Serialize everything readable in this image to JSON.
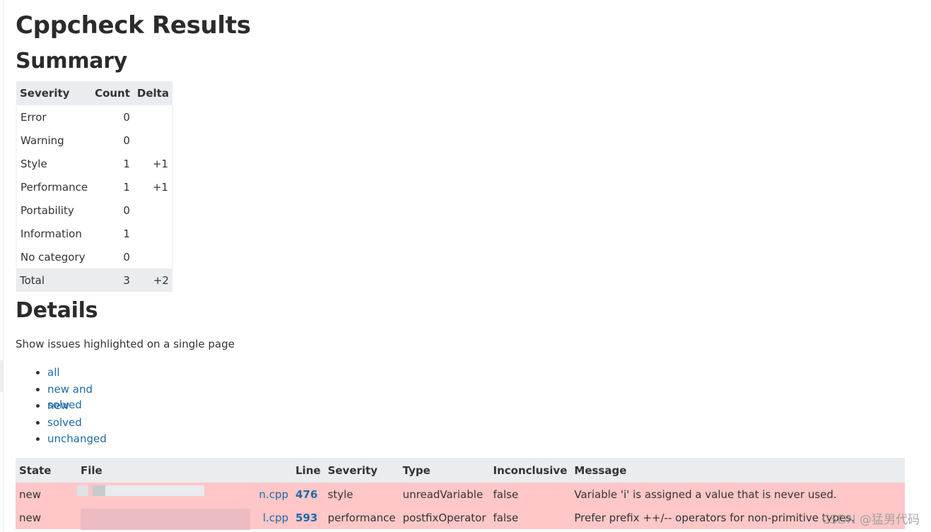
{
  "page": {
    "title": "Cppcheck Results",
    "summary_heading": "Summary",
    "details_heading": "Details",
    "intro_text": "Show issues highlighted on a single page"
  },
  "summary": {
    "headers": [
      "Severity",
      "Count",
      "Delta"
    ],
    "rows": [
      {
        "severity": "Error",
        "count": "0",
        "delta": ""
      },
      {
        "severity": "Warning",
        "count": "0",
        "delta": ""
      },
      {
        "severity": "Style",
        "count": "1",
        "delta": "+1"
      },
      {
        "severity": "Performance",
        "count": "1",
        "delta": "+1"
      },
      {
        "severity": "Portability",
        "count": "0",
        "delta": ""
      },
      {
        "severity": "Information",
        "count": "1",
        "delta": ""
      },
      {
        "severity": "No category",
        "count": "0",
        "delta": ""
      }
    ],
    "total": {
      "label": "Total",
      "count": "3",
      "delta": "+2"
    }
  },
  "links": [
    "all",
    "new and solved",
    "new",
    "solved",
    "unchanged"
  ],
  "details": {
    "headers": [
      "State",
      "File",
      "Line",
      "Severity",
      "Type",
      "Inconclusive",
      "Message"
    ],
    "rows": [
      {
        "state": "new",
        "file": "n.cpp",
        "line": "476",
        "severity": "style",
        "type": "unreadVariable",
        "inconclusive": "false",
        "message": "Variable 'i' is assigned a value that is never used."
      },
      {
        "state": "new",
        "file": "l.cpp",
        "line": "593",
        "severity": "performance",
        "type": "postfixOperator",
        "inconclusive": "false",
        "message": "Prefer prefix ++/-- operators for non-primitive types."
      }
    ]
  },
  "watermark": "CSDN @猛男代码",
  "colors": {
    "header_bg": "#e9edf0",
    "new_row_bg": "#ffc7c7",
    "link": "#1f6aa5",
    "text": "#333333"
  }
}
